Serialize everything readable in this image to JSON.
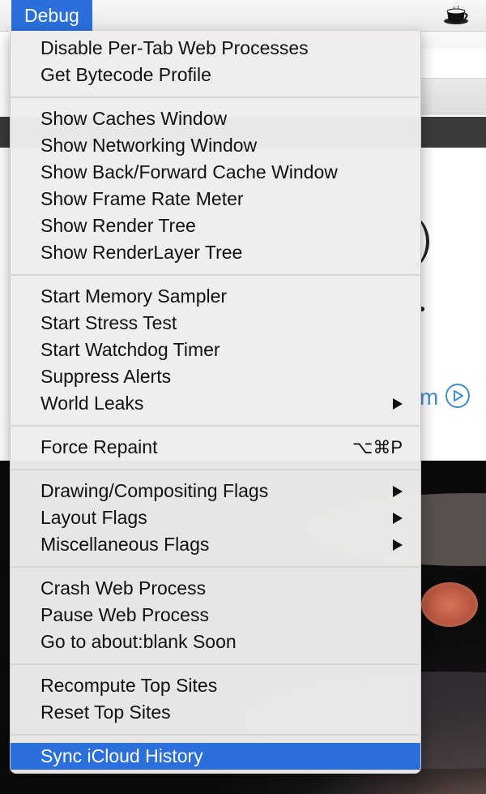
{
  "menubar": {
    "title": "Debug",
    "status_icon": "coffee-cup-icon"
  },
  "background": {
    "link_fragment": "m",
    "play_icon": "play-circle-icon"
  },
  "menu": {
    "groups": [
      {
        "items": [
          {
            "label": "Disable Per-Tab Web Processes"
          },
          {
            "label": "Get Bytecode Profile"
          }
        ]
      },
      {
        "items": [
          {
            "label": "Show Caches Window"
          },
          {
            "label": "Show Networking Window"
          },
          {
            "label": "Show Back/Forward Cache Window"
          },
          {
            "label": "Show Frame Rate Meter"
          },
          {
            "label": "Show Render Tree"
          },
          {
            "label": "Show RenderLayer Tree"
          }
        ]
      },
      {
        "items": [
          {
            "label": "Start Memory Sampler"
          },
          {
            "label": "Start Stress Test"
          },
          {
            "label": "Start Watchdog Timer"
          },
          {
            "label": "Suppress Alerts"
          },
          {
            "label": "World Leaks",
            "submenu": true
          }
        ]
      },
      {
        "items": [
          {
            "label": "Force Repaint",
            "shortcut": "⌥⌘P"
          }
        ]
      },
      {
        "items": [
          {
            "label": "Drawing/Compositing Flags",
            "submenu": true
          },
          {
            "label": "Layout Flags",
            "submenu": true
          },
          {
            "label": "Miscellaneous Flags",
            "submenu": true
          }
        ]
      },
      {
        "items": [
          {
            "label": "Crash Web Process"
          },
          {
            "label": "Pause Web Process"
          },
          {
            "label": "Go to about:blank Soon"
          }
        ]
      },
      {
        "items": [
          {
            "label": "Recompute Top Sites"
          },
          {
            "label": "Reset Top Sites"
          }
        ]
      },
      {
        "items": [
          {
            "label": "Sync iCloud History",
            "highlighted": true
          }
        ]
      }
    ]
  },
  "colors": {
    "highlight": "#2a6fdc",
    "menu_background": "#eeecec",
    "link": "#3f8fd3"
  }
}
